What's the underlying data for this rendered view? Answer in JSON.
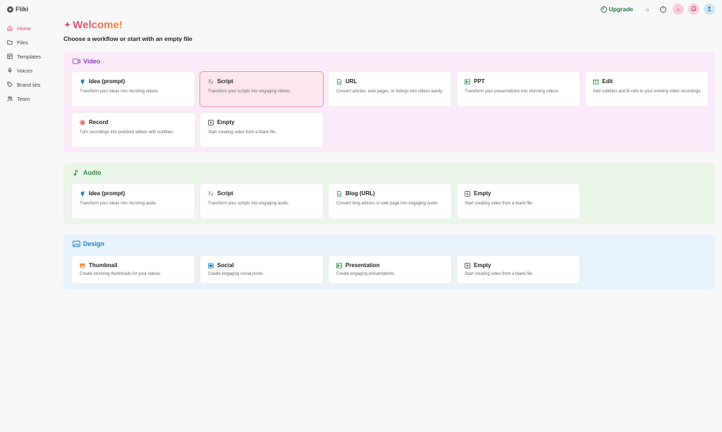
{
  "app": {
    "name": "Fliki"
  },
  "sidebar": {
    "items": [
      {
        "label": "Home",
        "icon": "home-icon",
        "active": true
      },
      {
        "label": "Files",
        "icon": "folder-icon",
        "active": false
      },
      {
        "label": "Templates",
        "icon": "template-icon",
        "active": false
      },
      {
        "label": "Voices",
        "icon": "microphone-icon",
        "active": false
      },
      {
        "label": "Brand kits",
        "icon": "tag-icon",
        "active": false
      },
      {
        "label": "Team",
        "icon": "team-icon",
        "active": false
      }
    ]
  },
  "topbar": {
    "upgrade_label": "Upgrade"
  },
  "main": {
    "welcome": "Welcome!",
    "subtitle": "Choose a workflow or start with an empty file"
  },
  "sections": {
    "video": {
      "title": "Video",
      "cards": [
        {
          "title": "Idea (prompt)",
          "desc": "Transform your ideas into stunning videos."
        },
        {
          "title": "Script",
          "desc": "Transform your scripts into engaging videos."
        },
        {
          "title": "URL",
          "desc": "Convert articles, web pages, or listings into videos easily."
        },
        {
          "title": "PPT",
          "desc": "Transform your presentations into stunning videos."
        },
        {
          "title": "Edit",
          "desc": "Add subtitles and B-rolls to your existing video recordings."
        },
        {
          "title": "Record",
          "desc": "Turn recordings into polished videos with subtitles."
        },
        {
          "title": "Empty",
          "desc": "Start creating video from a blank file."
        }
      ]
    },
    "audio": {
      "title": "Audio",
      "cards": [
        {
          "title": "Idea (prompt)",
          "desc": "Transform your ideas into stunning audio."
        },
        {
          "title": "Script",
          "desc": "Transform your scripts into engaging audio."
        },
        {
          "title": "Blog (URL)",
          "desc": "Convert blog articles or web page into engaging audio."
        },
        {
          "title": "Empty",
          "desc": "Start creating video from a blank file."
        }
      ]
    },
    "design": {
      "title": "Design",
      "cards": [
        {
          "title": "Thumbnail",
          "desc": "Create stunning thumbnails for your videos."
        },
        {
          "title": "Social",
          "desc": "Create engaging social posts."
        },
        {
          "title": "Presentation",
          "desc": "Create engaging presentations."
        },
        {
          "title": "Empty",
          "desc": "Start creating video from a blank file."
        }
      ]
    }
  },
  "colors": {
    "accent": "#e0457b",
    "video": "#8a3fc7",
    "audio": "#2f8a44",
    "design": "#1e82c6"
  }
}
